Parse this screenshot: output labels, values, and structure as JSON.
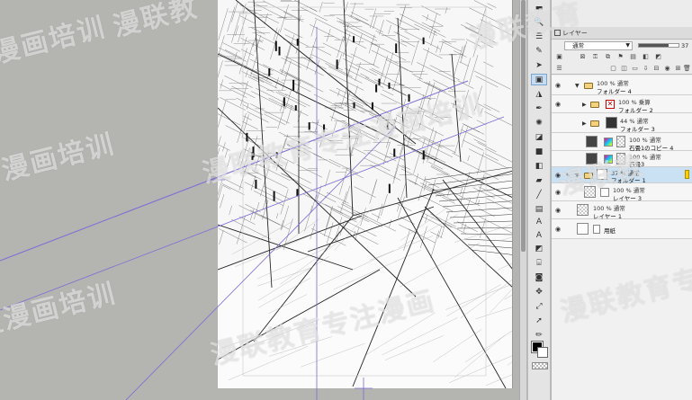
{
  "layer_panel": {
    "tab_label": "レイヤー",
    "blend_mode": "通常",
    "opacity_value": "37",
    "opacity_fraction": 0.75,
    "layers": [
      {
        "top": "100 % 通常",
        "name": "フォルダー 4",
        "kind": "folder",
        "indent": 0,
        "expanded": true
      },
      {
        "top": "100 % 乗算",
        "name": "フォルダー 2",
        "kind": "folder-mask",
        "indent": 1,
        "expanded": false
      },
      {
        "top": "44 % 通常",
        "name": "フォルダー 3",
        "kind": "folder-thumb",
        "indent": 1,
        "expanded": false
      },
      {
        "top": "100 % 通常",
        "name": "石畳1のコピー 4",
        "kind": "raster-mask",
        "indent": 2,
        "expanded": false
      },
      {
        "top": "100 % 通常",
        "name": "石畳3",
        "kind": "raster-mask",
        "indent": 2,
        "expanded": false
      },
      {
        "top": "37 % 通常",
        "name": "フォルダー 1",
        "kind": "folder-sel",
        "indent": 0,
        "expanded": true
      },
      {
        "top": "100 % 通常",
        "name": "レイヤー 3",
        "kind": "raster-mask",
        "indent": 1,
        "expanded": false
      },
      {
        "top": "100 % 通常",
        "name": "レイヤー 1",
        "kind": "raster",
        "indent": 0,
        "expanded": false
      },
      {
        "top": "",
        "name": "用紙",
        "kind": "paper",
        "indent": 0,
        "expanded": false
      }
    ]
  },
  "watermark": {
    "lines": [
      "漫联教育专注漫画培训",
      "漫画培训",
      "漫联教",
      "漫画培训",
      "漫联教育专注",
      "漫联教育",
      "注漫画培训",
      "漫联教育专注漫画"
    ]
  },
  "colors": {
    "selection": "#c9e1f3",
    "panel_bg": "#ececec",
    "canvas_bg": "#b4b4b1",
    "guide": "#6f5bd6"
  }
}
